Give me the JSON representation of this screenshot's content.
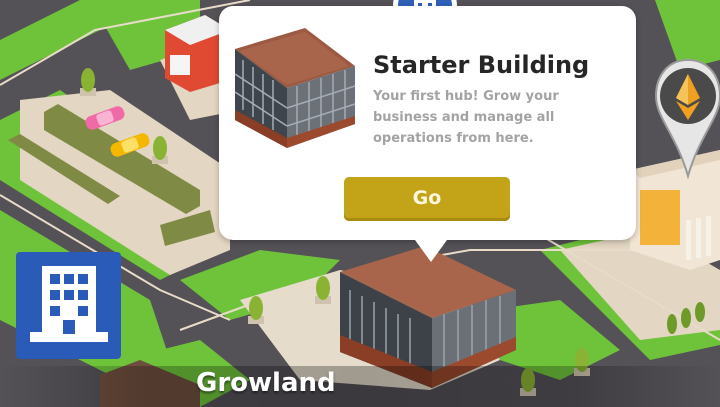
{
  "popup": {
    "title": "Starter Building",
    "description": "Your first hub! Grow your business and manage all operations from here.",
    "go_label": "Go"
  },
  "region": {
    "name": "Growland"
  },
  "icons": {
    "popup_badge": "office-building-icon",
    "left_button": "office-building-icon",
    "map_pin": "ethereum-icon"
  },
  "colors": {
    "go_button": "#c3a317",
    "building_button": "#2a5bb8",
    "badge_blue": "#2f5fb9",
    "pin_orange": "#f0a020",
    "grass": "#6ec23a",
    "road": "#4d4b4e",
    "sidewalk": "#e3d6c2"
  }
}
